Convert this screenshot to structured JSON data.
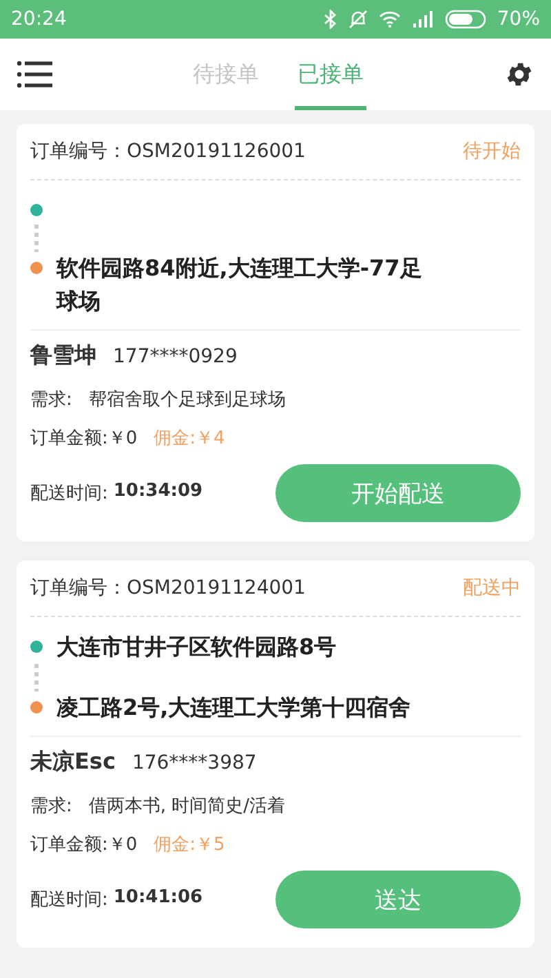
{
  "status_bar": {
    "time": "20:24",
    "battery": "70%"
  },
  "header": {
    "tabs": [
      {
        "label": "待接单",
        "selected": false
      },
      {
        "label": "已接单",
        "selected": true
      }
    ]
  },
  "orders": [
    {
      "order_label": "订单编号：",
      "order_no": "OSM20191126001",
      "status": "待开始",
      "stops": [
        {
          "kind": "origin"
        },
        {
          "kind": "destination",
          "address": "软件园路84附近,大连理工大学-77足球场"
        }
      ],
      "customer": "鲁雪坤",
      "phone": "177****0929",
      "need_label": "需求:",
      "need": "帮宿舍取个足球到足球场",
      "amount": "订单金额:￥0",
      "commission": "佣金:￥4",
      "time_label": "配送时间:",
      "time": "10:34:09",
      "action": "开始配送"
    },
    {
      "order_label": "订单编号：",
      "order_no": "OSM20191124001",
      "status": "配送中",
      "stops": [
        {
          "kind": "origin",
          "address": "大连市甘井子区软件园路8号"
        },
        {
          "kind": "destination",
          "address": "凌工路2号,大连理工大学第十四宿舍"
        }
      ],
      "customer": "未凉Esc",
      "phone": "176****3987",
      "need_label": "需求:",
      "need": "借两本书, 时间简史/活着",
      "amount": "订单金额:￥0",
      "commission": "佣金:￥5",
      "time_label": "配送时间:",
      "time": "10:41:06",
      "action": "送达"
    }
  ]
}
